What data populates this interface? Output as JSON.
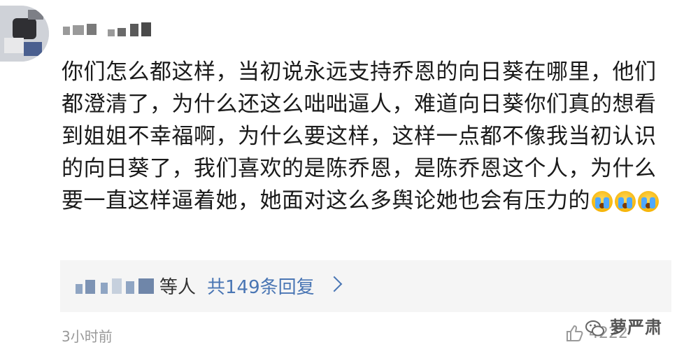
{
  "comment": {
    "text": "你们怎么都这样，当初说永远支持乔恩的向日葵在哪里，他们都澄清了，为什么还这么咄咄逼人，难道向日葵你们真的想看到姐姐不幸福啊，为什么要这样，这样一点都不像我当初认识的向日葵了，我们喜欢的是陈乔恩，是陈乔恩这个人，为什么要一直这样逼着她，她面对这么多舆论她也会有压力的",
    "emojis": [
      "crying-face-icon",
      "crying-face-icon",
      "crying-face-icon"
    ]
  },
  "replies": {
    "suffix": "等人",
    "count_text": "共149条回复"
  },
  "meta": {
    "time": "3小时前",
    "likes": "4222"
  },
  "watermark": {
    "text": "萝严肃"
  },
  "colors": {
    "link": "#4a76b4",
    "text": "#1a1a1a",
    "muted": "#999999",
    "reply_bg": "#f5f5f5"
  }
}
